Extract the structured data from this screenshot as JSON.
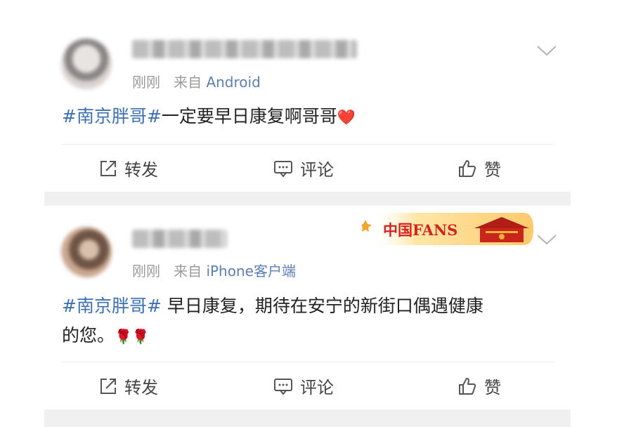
{
  "posts": [
    {
      "time": "刚刚",
      "from_prefix": "来自",
      "source": "Android",
      "hashtag": "#南京胖哥#",
      "text": "一定要早日康复啊哥哥",
      "emoji": "❤️",
      "actions": {
        "repost": "转发",
        "comment": "评论",
        "like": "赞"
      }
    },
    {
      "time": "刚刚",
      "from_prefix": "来自",
      "source": "iPhone客户端",
      "hashtag": "#南京胖哥#",
      "text": " 早日康复，期待在安宁的新街口偶遇健康",
      "text_line2": "的您。",
      "emoji": "🌹🌹",
      "badge_label": "中国FANS",
      "actions": {
        "repost": "转发",
        "comment": "评论",
        "like": "赞"
      }
    }
  ],
  "colors": {
    "link": "#3d6fb3",
    "meta": "#9a9a9a",
    "separator": "#f0f0f0"
  }
}
